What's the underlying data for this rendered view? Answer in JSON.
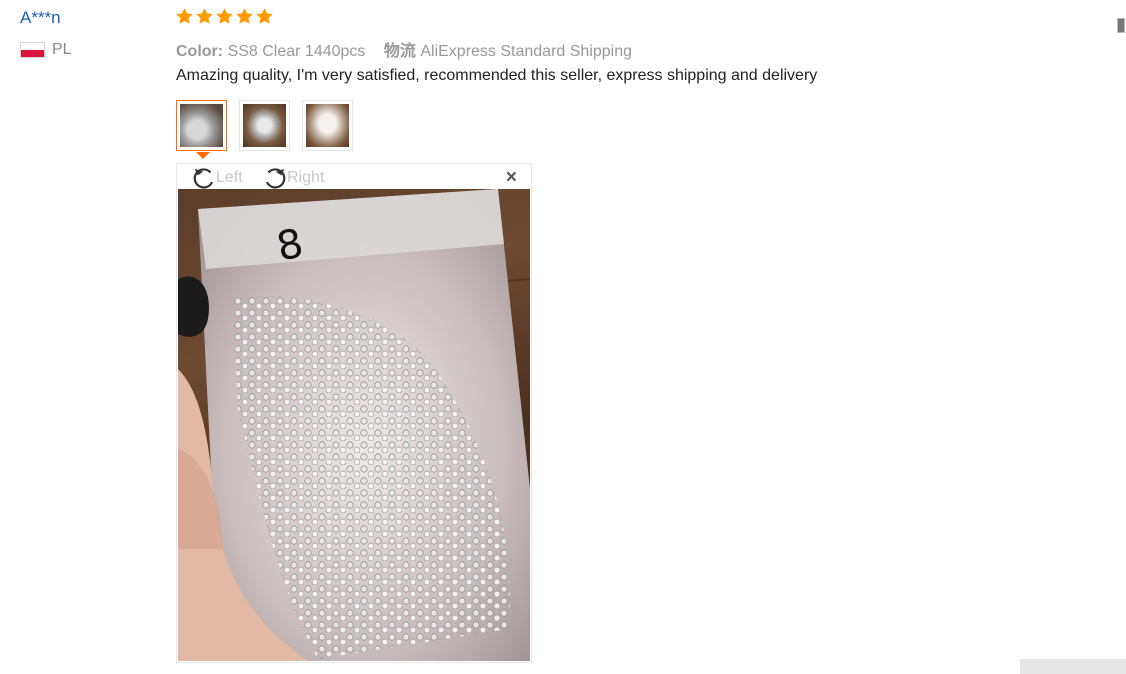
{
  "review": {
    "username": "A***n",
    "country_code": "PL",
    "rating": 5,
    "color_label": "Color:",
    "color_value": "SS8 Clear 1440pcs",
    "shipping_label": "物流",
    "shipping_value": "AliExpress Standard Shipping",
    "text": "Amazing quality, I'm very satisfied, recommended this seller, express shipping and delivery"
  },
  "thumbnails": [
    "photo-1",
    "photo-2",
    "photo-3"
  ],
  "viewer": {
    "rotate_left_label": "Left",
    "rotate_right_label": "Right",
    "close_icon": "×",
    "bag_mark": "8"
  },
  "colors": {
    "username": "#1a5fb4",
    "star": "#ff9a00",
    "active_border": "#ff6a00",
    "flag_red": "#dc143c"
  }
}
